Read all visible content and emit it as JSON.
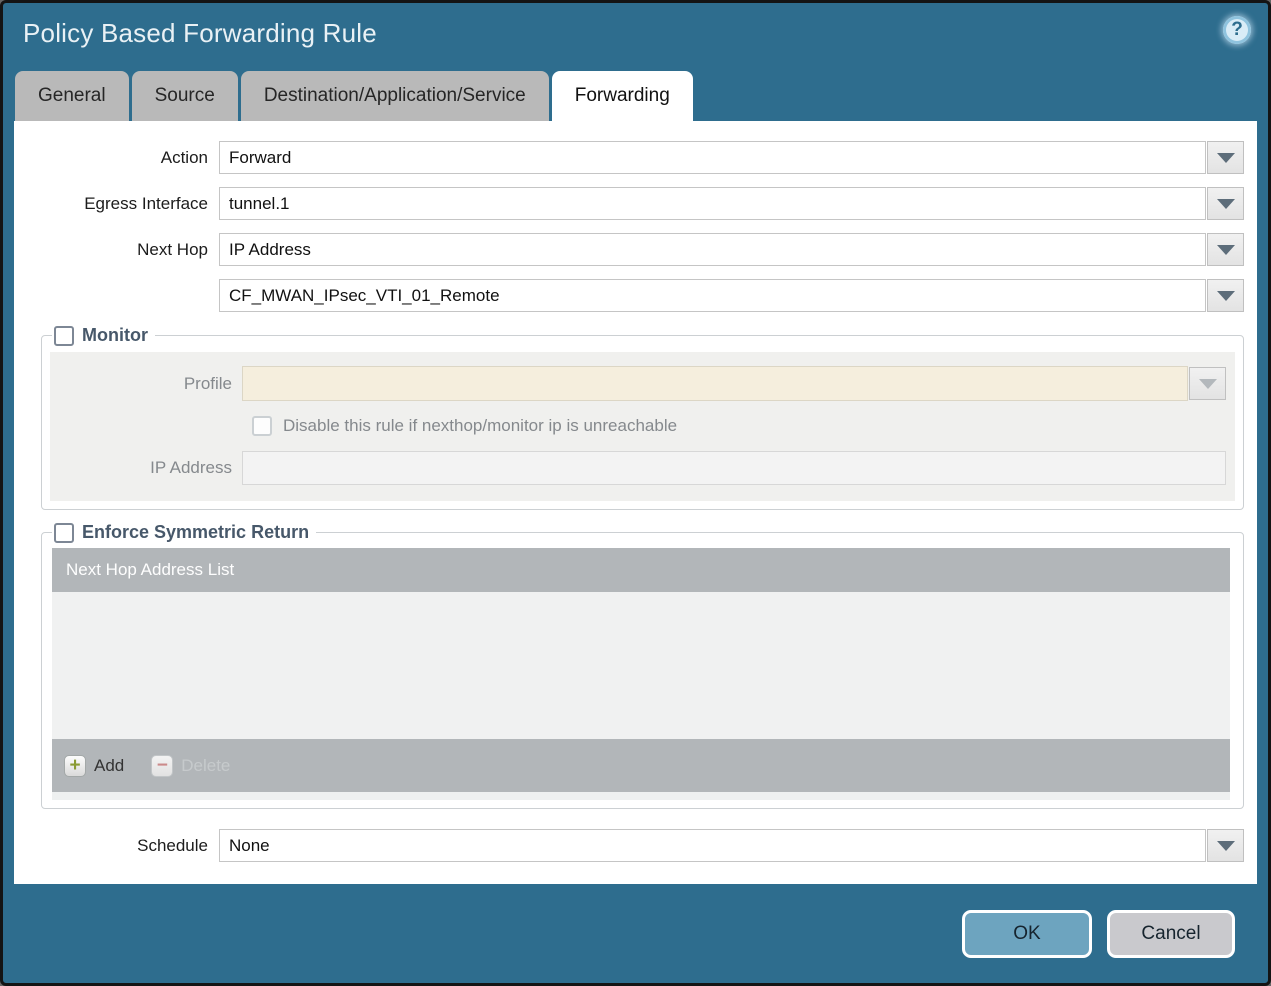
{
  "window": {
    "title": "Policy Based Forwarding Rule",
    "help_icon": "?"
  },
  "tabs": {
    "items": [
      {
        "label": "General"
      },
      {
        "label": "Source"
      },
      {
        "label": "Destination/Application/Service"
      },
      {
        "label": "Forwarding"
      }
    ],
    "active": "Forwarding"
  },
  "form": {
    "action": {
      "label": "Action",
      "value": "Forward"
    },
    "egress_interface": {
      "label": "Egress Interface",
      "value": "tunnel.1"
    },
    "next_hop": {
      "label": "Next Hop",
      "value": "IP Address"
    },
    "next_hop_address": {
      "value": "CF_MWAN_IPsec_VTI_01_Remote"
    },
    "schedule": {
      "label": "Schedule",
      "value": "None"
    }
  },
  "monitor": {
    "legend": "Monitor",
    "checked": false,
    "profile": {
      "label": "Profile",
      "value": ""
    },
    "disable_rule": {
      "label": "Disable this rule if nexthop/monitor ip is unreachable",
      "checked": false
    },
    "ip_address": {
      "label": "IP Address",
      "value": ""
    }
  },
  "symmetric_return": {
    "legend": "Enforce Symmetric Return",
    "checked": false,
    "table": {
      "header": "Next Hop Address List",
      "rows": []
    },
    "add_label": "Add",
    "delete_label": "Delete",
    "add_icon": "+",
    "delete_icon": "−"
  },
  "footer": {
    "ok_label": "OK",
    "cancel_label": "Cancel"
  },
  "colors": {
    "chrome": "#2e6d8e",
    "ok_button": "#6da4bf",
    "cancel_button": "#c9c9cd",
    "table_header": "#b2b6b9",
    "disabled_field_cream": "#f5eedd",
    "disabled_panel": "#f0f0ee"
  }
}
